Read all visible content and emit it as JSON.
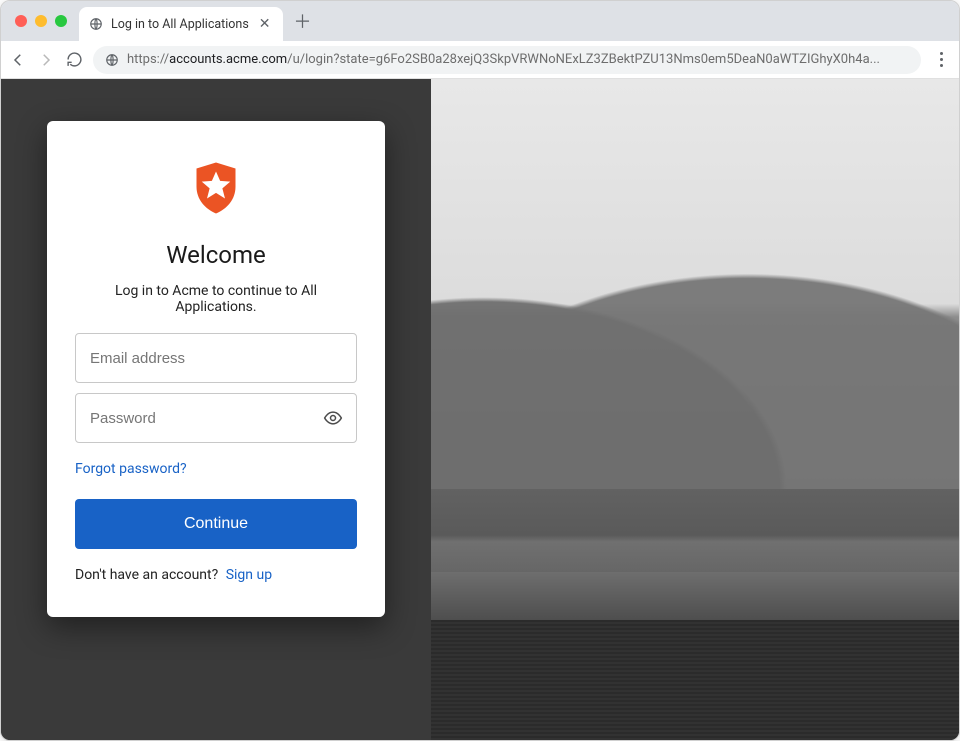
{
  "browser": {
    "tab_title": "Log in to All Applications",
    "url_prefix": "https://",
    "url_host": "accounts.acme.com",
    "url_path": "/u/login?state=g6Fo2SB0a28xejQ3SkpVRWNoNExLZ3ZBektPZU13Nms0em5DeaN0aWTZIGhyX0h4a..."
  },
  "login": {
    "heading": "Welcome",
    "subtext": "Log in to Acme to continue to All Applications.",
    "email_placeholder": "Email address",
    "password_placeholder": "Password",
    "forgot_label": "Forgot password?",
    "continue_label": "Continue",
    "signup_prompt": "Don't have an account?",
    "signup_link": "Sign up"
  },
  "colors": {
    "brand_orange": "#eb5424",
    "primary_blue": "#1862c6",
    "page_bg": "#3a3a3a"
  }
}
